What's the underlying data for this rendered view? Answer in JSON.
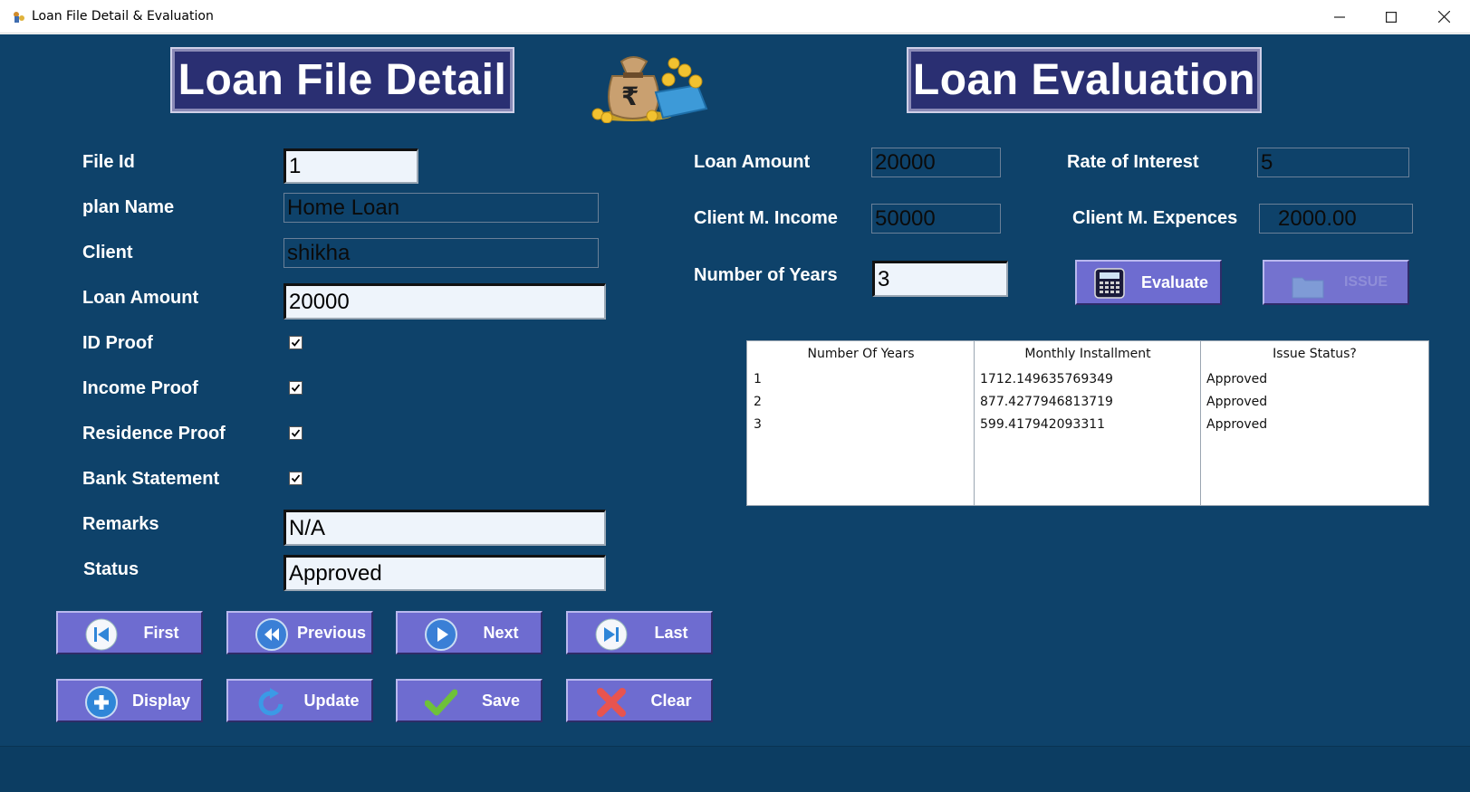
{
  "window": {
    "title": "Loan File Detail & Evaluation",
    "minimize_icon": "minimize-icon",
    "maximize_icon": "maximize-icon",
    "close_icon": "close-icon"
  },
  "headers": {
    "left": "Loan File Detail",
    "right": "Loan Evaluation"
  },
  "file_detail": {
    "file_id_label": "File Id",
    "file_id": "1",
    "plan_name_label": "plan Name",
    "plan_name": "Home Loan",
    "client_label": "Client",
    "client": "shikha",
    "loan_amount_label": "Loan Amount",
    "loan_amount": "20000",
    "id_proof_label": "ID Proof",
    "id_proof_checked": true,
    "income_proof_label": "Income Proof",
    "income_proof_checked": true,
    "residence_proof_label": "Residence Proof",
    "residence_proof_checked": true,
    "bank_statement_label": "Bank Statement",
    "bank_statement_checked": true,
    "remarks_label": "Remarks",
    "remarks": "N/A",
    "status_label": "Status",
    "status": "Approved"
  },
  "evaluation": {
    "loan_amount_label": "Loan Amount",
    "loan_amount": "20000",
    "rate_label": "Rate of Interest",
    "rate": "5",
    "income_label": "Client M. Income",
    "income": "50000",
    "expences_label": "Client M. Expences",
    "expences": "2000.00",
    "years_label": "Number of Years",
    "years": "3",
    "evaluate_label": "Evaluate",
    "issue_label": "ISSUE"
  },
  "table": {
    "headers": [
      "Number Of Years",
      "Monthly Installment",
      "Issue Status?"
    ],
    "rows": [
      [
        "1",
        "1712.149635769349",
        "Approved"
      ],
      [
        "2",
        "877.4277946813719",
        "Approved"
      ],
      [
        "3",
        "599.417942093311",
        "Approved"
      ]
    ]
  },
  "buttons": {
    "first": "First",
    "previous": "Previous",
    "next": "Next",
    "last": "Last",
    "display": "Display",
    "update": "Update",
    "save": "Save",
    "clear": "Clear"
  },
  "colors": {
    "panel": "#0e426a",
    "button": "#6e6cd0",
    "banner": "#2a2f72"
  }
}
